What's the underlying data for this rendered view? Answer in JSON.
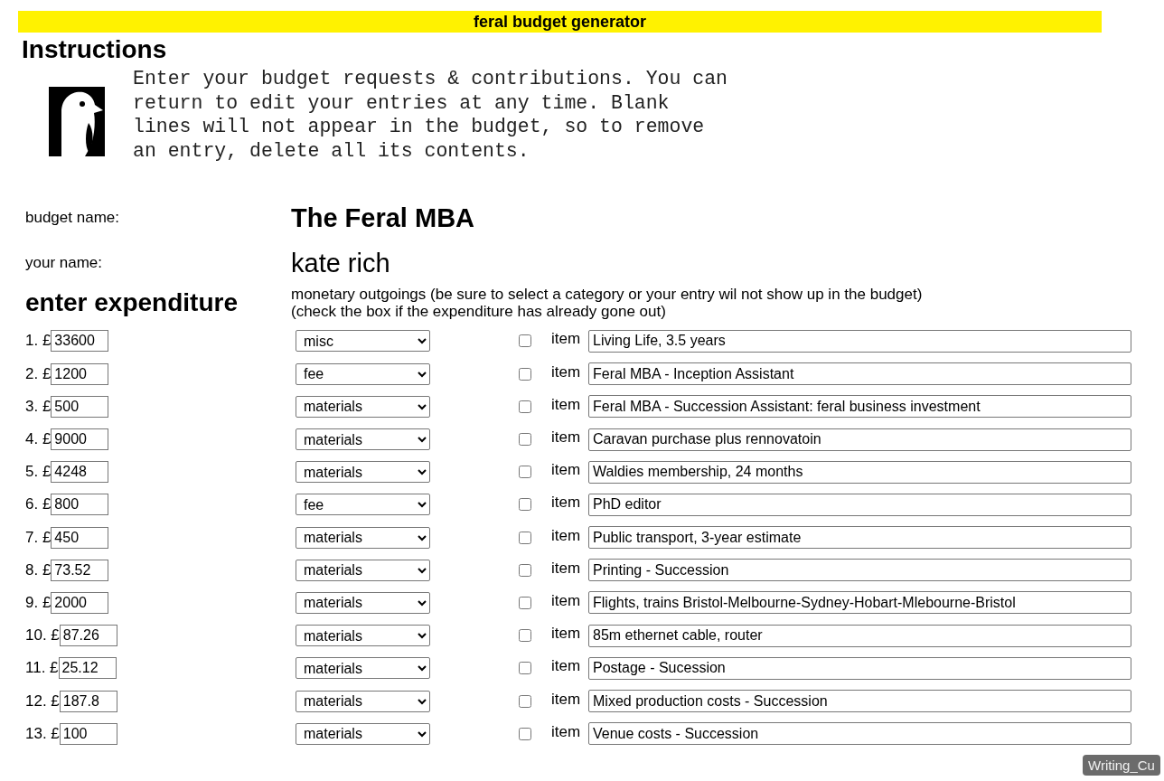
{
  "banner": {
    "title": "feral budget generator"
  },
  "instructions": {
    "heading": "Instructions",
    "text": "Enter your budget requests & contributions. You can return to edit your entries at any time. Blank lines will not appear in the budget, so to remove an entry, delete all its contents."
  },
  "fields": [
    {
      "label": "budget name:",
      "value": "The Feral MBA",
      "kind": "title"
    },
    {
      "label": "your name:",
      "value": "kate rich",
      "kind": "name"
    }
  ],
  "expenditure": {
    "heading": "enter expenditure",
    "note_lines": [
      "monetary outgoings (be sure to select a category or your entry wil not show up in the budget)",
      "(check the box if the expenditure has already gone out)"
    ],
    "rows": [
      {
        "number": "1. £",
        "amount": "33600",
        "category": "misc",
        "checked": false,
        "item_label": "item",
        "item": "Living Life, 3.5 years"
      },
      {
        "number": "2. £",
        "amount": "1200",
        "category": "fee",
        "checked": false,
        "item_label": "item",
        "item": "Feral MBA - Inception Assistant"
      },
      {
        "number": "3. £",
        "amount": "500",
        "category": "materials",
        "checked": false,
        "item_label": "item",
        "item": "Feral MBA - Succession Assistant: feral business investment"
      },
      {
        "number": "4. £",
        "amount": "9000",
        "category": "materials",
        "checked": false,
        "item_label": "item",
        "item": "Caravan purchase plus rennovatoin"
      },
      {
        "number": "5. £",
        "amount": "4248",
        "category": "materials",
        "checked": false,
        "item_label": "item",
        "item": "Waldies membership, 24 months"
      },
      {
        "number": "6. £",
        "amount": "800",
        "category": "fee",
        "checked": false,
        "item_label": "item",
        "item": "PhD editor"
      },
      {
        "number": "7. £",
        "amount": "450",
        "category": "materials",
        "checked": false,
        "item_label": "item",
        "item": "Public transport, 3-year estimate"
      },
      {
        "number": "8. £",
        "amount": "73.52",
        "category": "materials",
        "checked": false,
        "item_label": "item",
        "item": "Printing - Succession"
      },
      {
        "number": "9. £",
        "amount": "2000",
        "category": "materials",
        "checked": false,
        "item_label": "item",
        "item": "Flights, trains Bristol-Melbourne-Sydney-Hobart-Mlebourne-Bristol"
      },
      {
        "number": "10. £",
        "amount": "87.26",
        "category": "materials",
        "checked": false,
        "item_label": "item",
        "item": "85m ethernet cable, router"
      },
      {
        "number": "11. £",
        "amount": "25.12",
        "category": "materials",
        "checked": false,
        "item_label": "item",
        "item": "Postage - Sucession"
      },
      {
        "number": "12. £",
        "amount": "187.8",
        "category": "materials",
        "checked": false,
        "item_label": "item",
        "item": "Mixed production costs - Succession"
      },
      {
        "number": "13. £",
        "amount": "100",
        "category": "materials",
        "checked": false,
        "item_label": "item",
        "item": "Venue costs - Succession"
      }
    ]
  },
  "tooltip": {
    "text": "Writing_Cu"
  }
}
